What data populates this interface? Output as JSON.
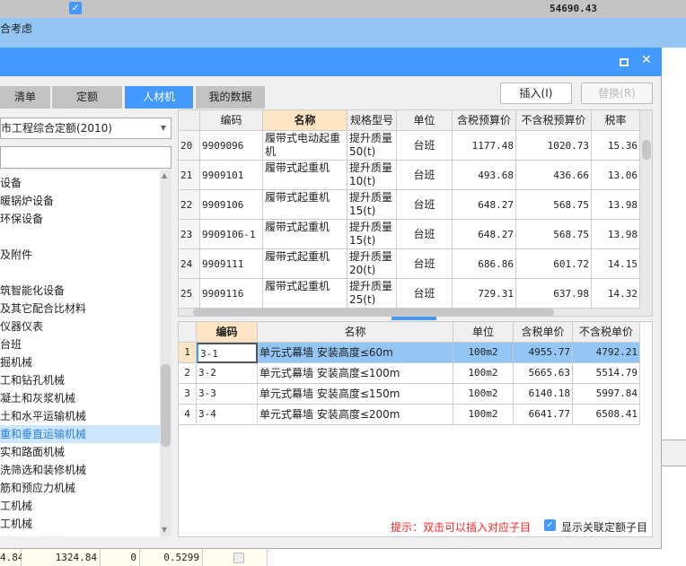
{
  "background": {
    "top_row_total": "54690.43",
    "second_row_text": "合考虑",
    "bottom_row": [
      "4.84",
      "1324.84",
      "0",
      "0.5299"
    ]
  },
  "dialog": {
    "tabs": [
      {
        "label": "清单"
      },
      {
        "label": "定额"
      },
      {
        "label": "人材机",
        "active": true
      },
      {
        "label": "我的数据"
      }
    ],
    "insert_label": "插入(I)",
    "replace_label": "替换(R)",
    "library_select": "市工程综合定额(2010)",
    "search_value": "",
    "tree": [
      {
        "label": "设备"
      },
      {
        "label": "暖锅炉设备"
      },
      {
        "label": "环保设备"
      },
      {
        "label": ""
      },
      {
        "label": "及附件"
      },
      {
        "label": ""
      },
      {
        "label": "筑智能化设备"
      },
      {
        "label": "及其它配合比材料"
      },
      {
        "label": "仪器仪表"
      },
      {
        "label": "台班"
      },
      {
        "label": "掘机械"
      },
      {
        "label": "工和钻孔机械"
      },
      {
        "label": "凝土和灰浆机械"
      },
      {
        "label": "土和水平运输机械"
      },
      {
        "label": "重和垂直运输机械",
        "selected": true
      },
      {
        "label": "实和路面机械"
      },
      {
        "label": "洗筛选和装修机械"
      },
      {
        "label": "筋和预应力机械"
      },
      {
        "label": "工机械"
      },
      {
        "label": "工机械"
      },
      {
        "label": "料和打磨机械"
      }
    ],
    "top_grid": {
      "headers": [
        "",
        "编码",
        "名称",
        "规格型号",
        "单位",
        "含税预算价",
        "不含税预算价",
        "税率"
      ],
      "rows": [
        [
          "20",
          "9909096",
          "履带式电动起重机",
          "提升质量50(t)",
          "台班",
          "1177.48",
          "1020.73",
          "15.36"
        ],
        [
          "21",
          "9909101",
          "履带式起重机",
          "提升质量10(t)",
          "台班",
          "493.68",
          "436.66",
          "13.06"
        ],
        [
          "22",
          "9909106",
          "履带式起重机",
          "提升质量15(t)",
          "台班",
          "648.27",
          "568.75",
          "13.98"
        ],
        [
          "23",
          "9909106-1",
          "履带式起重机",
          "提升质量15(t)",
          "台班",
          "648.27",
          "568.75",
          "13.98"
        ],
        [
          "24",
          "9909111",
          "履带式起重机",
          "提升质量20(t)",
          "台班",
          "686.86",
          "601.72",
          "14.15"
        ],
        [
          "25",
          "9909116",
          "履带式起重机",
          "提升质量25(t)",
          "台班",
          "729.31",
          "637.98",
          "14.32"
        ]
      ]
    },
    "bottom_grid": {
      "headers": [
        "",
        "编码",
        "名称",
        "单位",
        "含税单价",
        "不含税单价"
      ],
      "rows": [
        [
          "1",
          "3-1",
          "单元式幕墙 安装高度≤60m",
          "100m2",
          "4955.77",
          "4792.21"
        ],
        [
          "2",
          "3-2",
          "单元式幕墙 安装高度≤100m",
          "100m2",
          "5665.63",
          "5514.79"
        ],
        [
          "3",
          "3-3",
          "单元式幕墙 安装高度≤150m",
          "100m2",
          "6140.18",
          "5997.84"
        ],
        [
          "4",
          "3-4",
          "单元式幕墙 安装高度≤200m",
          "100m2",
          "6641.77",
          "6508.41"
        ]
      ]
    },
    "hint": "提示：双击可以插入对应子目",
    "show_related_label": "显示关联定额子目",
    "show_related_checked": true
  },
  "colors": {
    "accent": "#4499ff",
    "selected_row": "#93c6f5",
    "hint": "#ff2222",
    "highlight_header": "#fde4c4"
  }
}
